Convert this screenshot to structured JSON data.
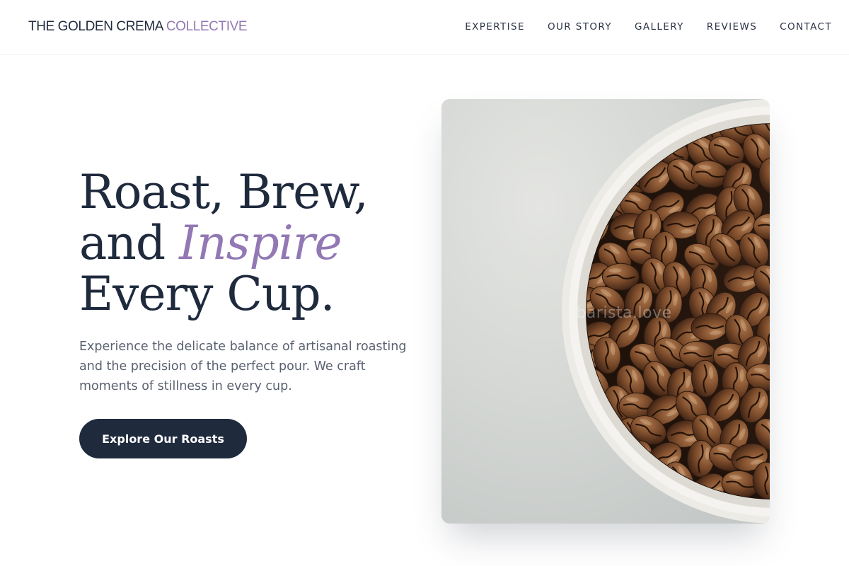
{
  "header": {
    "brand_main": "THE GOLDEN CREMA",
    "brand_accent": "COLLECTIVE",
    "nav": [
      "EXPERTISE",
      "OUR STORY",
      "GALLERY",
      "REVIEWS",
      "CONTACT"
    ]
  },
  "hero": {
    "title_line1": "Roast, Brew,",
    "title_line2_prefix": "and",
    "title_line2_accent": "Inspire",
    "title_line3": "Every Cup.",
    "description": "Experience the delicate balance of artisanal roasting and the precision of the perfect pour. We craft moments of stillness in every cup.",
    "cta_label": "Explore Our Roasts"
  },
  "image": {
    "subject": "bowl-of-coffee-beans",
    "watermark": "barista.love"
  },
  "colors": {
    "primary": "#1f2a3d",
    "accent": "#9278b4",
    "text_muted": "#5a6170"
  }
}
